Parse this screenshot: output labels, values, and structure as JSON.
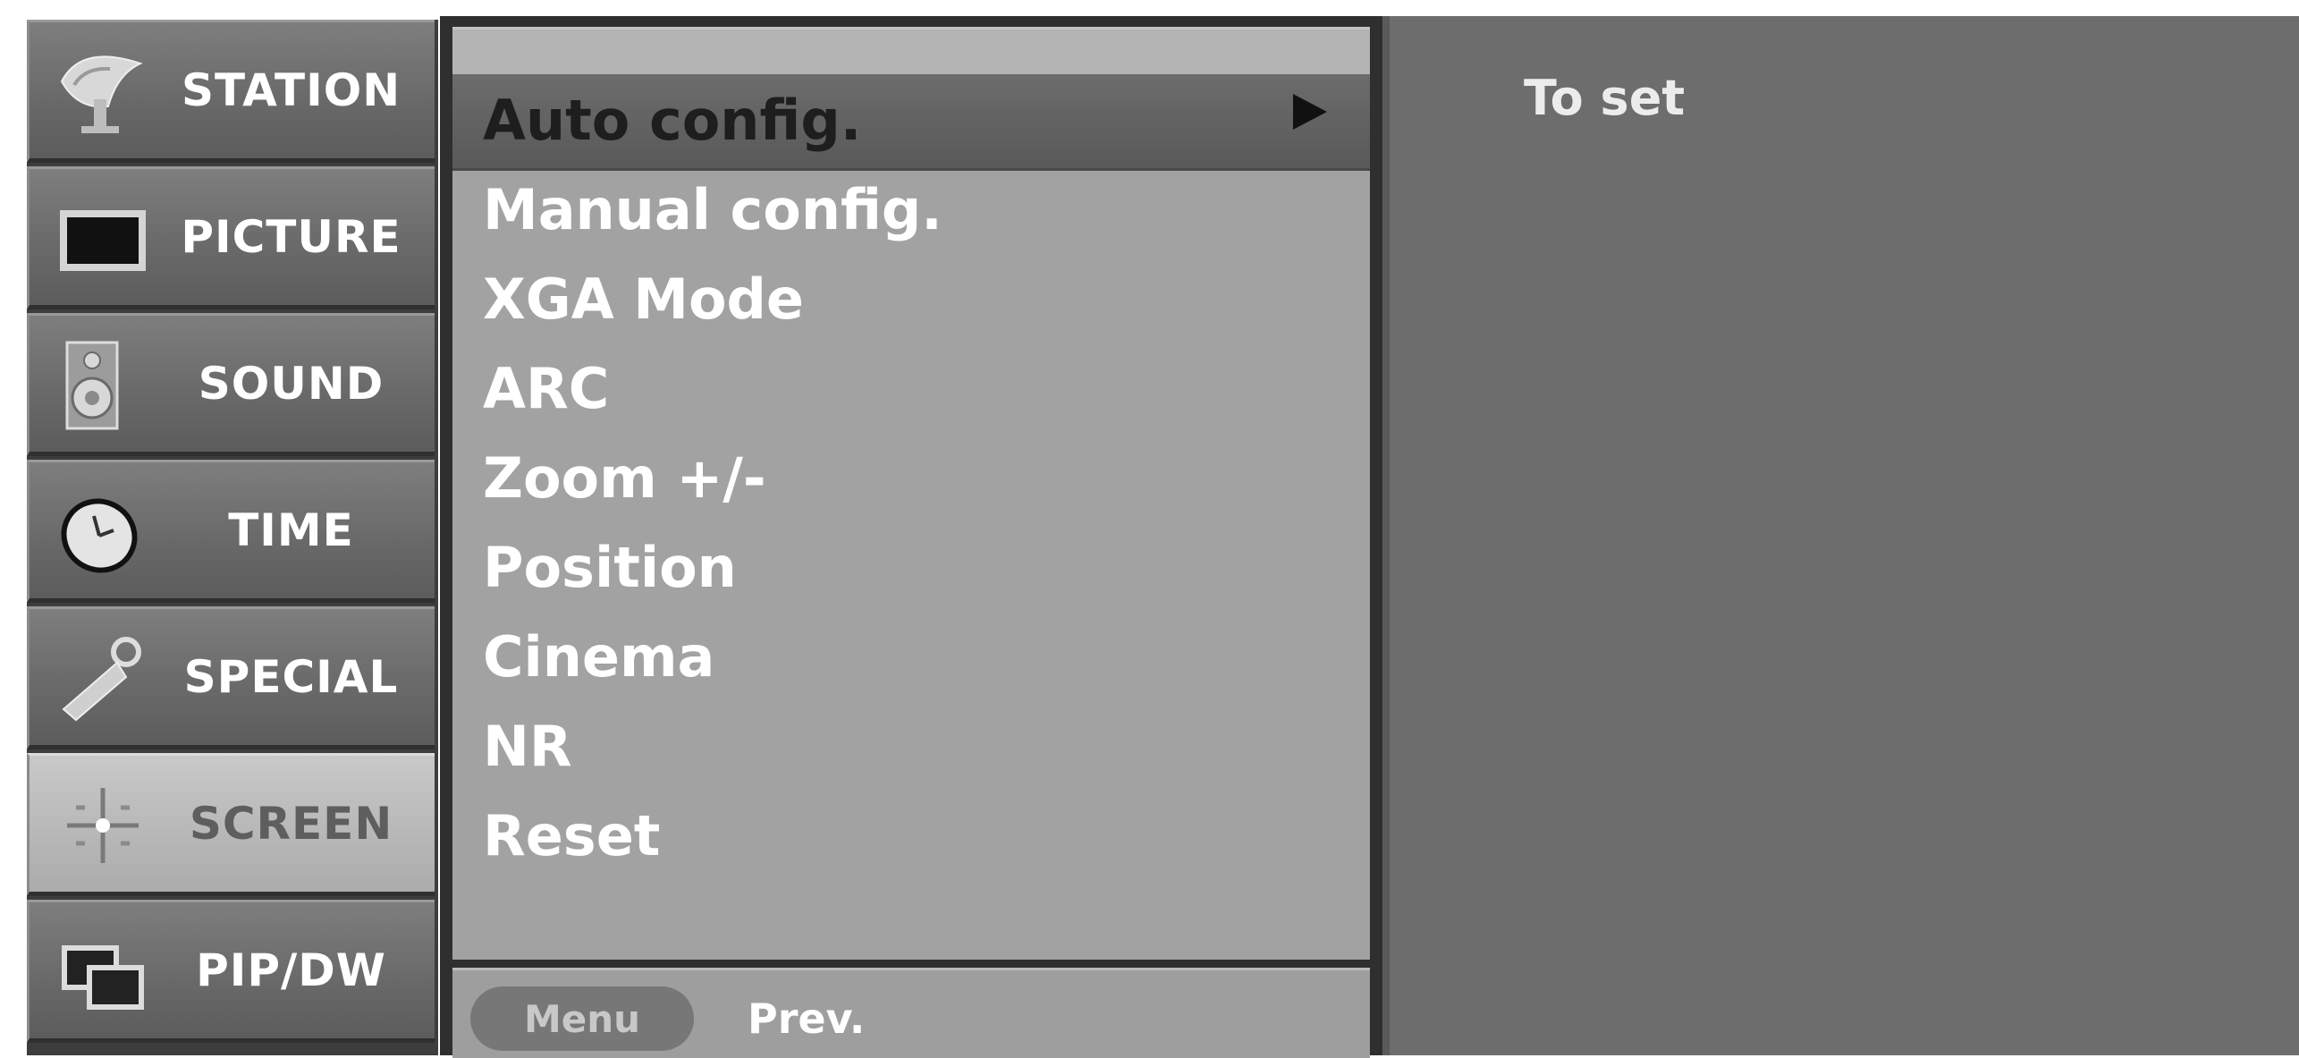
{
  "sidebar": {
    "items": [
      {
        "label": "STATION",
        "icon": "satellite-dish-icon",
        "active": false
      },
      {
        "label": "PICTURE",
        "icon": "picture-screen-icon",
        "active": false
      },
      {
        "label": "SOUND",
        "icon": "speaker-icon",
        "active": false
      },
      {
        "label": "TIME",
        "icon": "clock-icon",
        "active": false
      },
      {
        "label": "SPECIAL",
        "icon": "key-icon",
        "active": false
      },
      {
        "label": "SCREEN",
        "icon": "screen-adjust-icon",
        "active": true
      },
      {
        "label": "PIP/DW",
        "icon": "pip-windows-icon",
        "active": false
      }
    ]
  },
  "submenu": {
    "items": [
      {
        "label": "Auto config.",
        "selected": true
      },
      {
        "label": "Manual config.",
        "selected": false
      },
      {
        "label": "XGA Mode",
        "selected": false
      },
      {
        "label": "ARC",
        "selected": false
      },
      {
        "label": "Zoom +/-",
        "selected": false
      },
      {
        "label": "Position",
        "selected": false
      },
      {
        "label": "Cinema",
        "selected": false
      },
      {
        "label": "NR",
        "selected": false
      },
      {
        "label": "Reset",
        "selected": false
      }
    ],
    "arrow_icon": "play-arrow-icon"
  },
  "footer": {
    "menu_button": "Menu",
    "prev_label": "Prev."
  },
  "help": {
    "text": "To set"
  },
  "colors": {
    "sidebar_item": "#6e6e6e",
    "sidebar_item_active": "#bdbdbd",
    "submenu_bg": "#a2a2a2",
    "selection_bar": "#626262",
    "help_bg": "#6d6d6d"
  }
}
